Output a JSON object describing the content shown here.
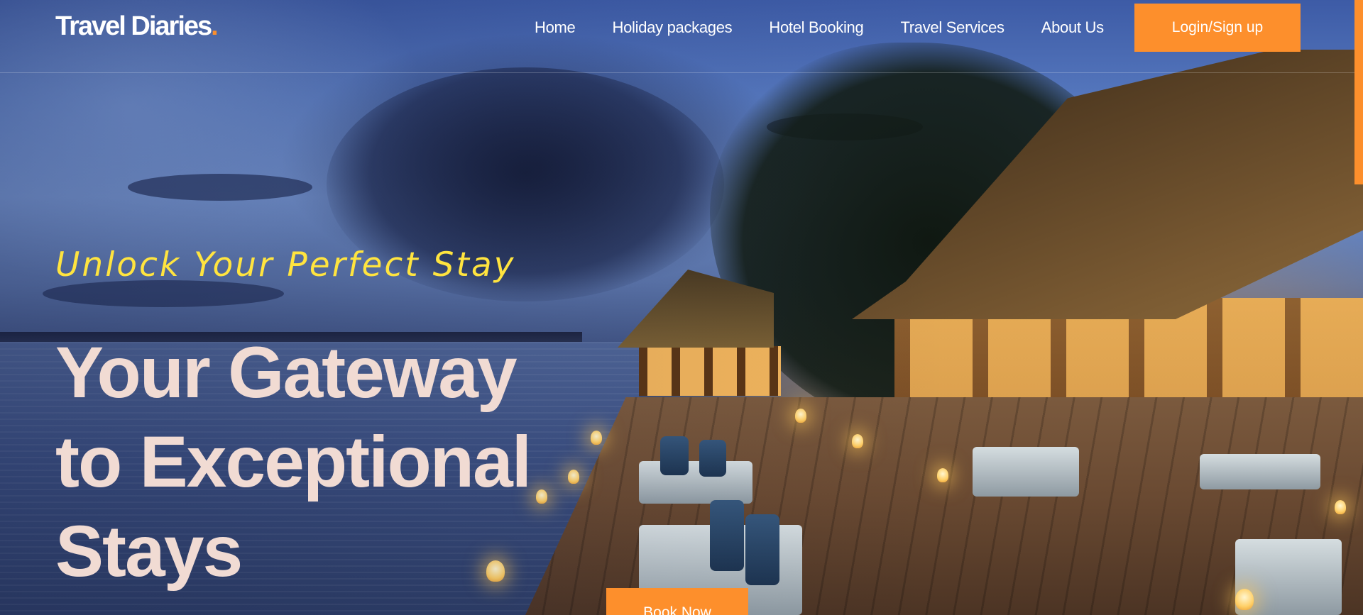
{
  "brand": {
    "name": "Travel Diaries",
    "dot": ".",
    "dot_color": "#fd8f2c"
  },
  "nav": {
    "links": [
      {
        "label": "Home",
        "icon": ""
      },
      {
        "label": "Holiday packages",
        "icon": ""
      },
      {
        "label": "Hotel Booking",
        "icon": ""
      },
      {
        "label": "Travel Services",
        "icon": ""
      },
      {
        "label": "About Us",
        "icon": ""
      }
    ],
    "login_label": "Login/Sign up"
  },
  "hero": {
    "tagline": "Unlock Your Perfect Stay",
    "headline": "Your Gateway to Exceptional Stays",
    "cta_label": "Book Now",
    "background_image": "overwater-resort-at-dusk"
  },
  "colors": {
    "accent": "#fd8f2c",
    "tagline": "#ffe43f",
    "headline": "#f1dbd3",
    "nav_text": "#ffffff"
  }
}
